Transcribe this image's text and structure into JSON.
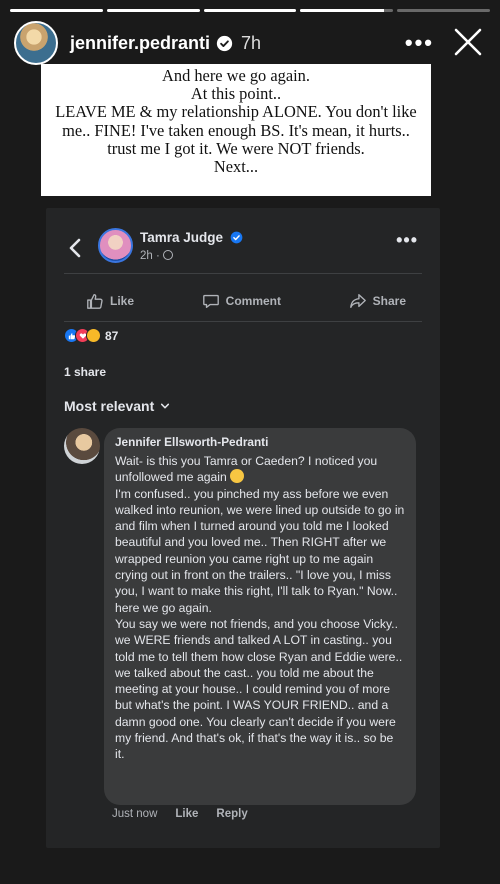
{
  "story": {
    "progress": [
      1,
      1,
      1,
      0.9,
      0
    ],
    "username": "jennifer.pedranti",
    "time": "7h",
    "more": "•••"
  },
  "caption": {
    "lines": [
      "And here we go again.",
      "At this point..",
      "LEAVE ME & my relationship ALONE. You don't like me.. FINE! I've taken enough BS. It's mean, it hurts.. trust me I got it. We were NOT friends.",
      "Next..."
    ]
  },
  "post": {
    "author": "Tamra Judge",
    "time": "2h ·",
    "more": "•••",
    "actions": {
      "like": "Like",
      "comment": "Comment",
      "share": "Share"
    },
    "reaction_count": "87",
    "shares": "1 share",
    "sort_label": "Most relevant"
  },
  "comment": {
    "author": "Jennifer Ellsworth-Pedranti",
    "paragraph1": "Wait- is this you Tamra or Caeden? I noticed you unfollowed me again",
    "paragraph2": "I'm confused.. you pinched my ass before we even walked into reunion, we were lined up outside to go in and film when I turned around you told me I looked beautiful and you loved me.. Then RIGHT after we wrapped reunion you came right up to me again crying out in front on the trailers.. \"I love you, I miss you, I want to make this right, I'll talk to Ryan.\" Now.. here we go again.",
    "paragraph3": "You say we were not friends, and you choose Vicky.. we WERE friends and talked A LOT in casting.. you told me to tell them how close Ryan and Eddie were.. we talked about the cast.. you told me about the meeting at your house.. I could remind you of more but what's the point. I WAS YOUR FRIEND.. and a damn good one. You clearly can't decide if you were my friend. And that's ok, if that's the way it is.. so be it.",
    "time": "Just now",
    "like": "Like",
    "reply": "Reply"
  },
  "colors": {
    "background": "#1a1a1a",
    "card": "#242526",
    "bubble": "#3a3b3c",
    "verified": "#3897f0",
    "text_secondary": "#b0b3b8"
  }
}
